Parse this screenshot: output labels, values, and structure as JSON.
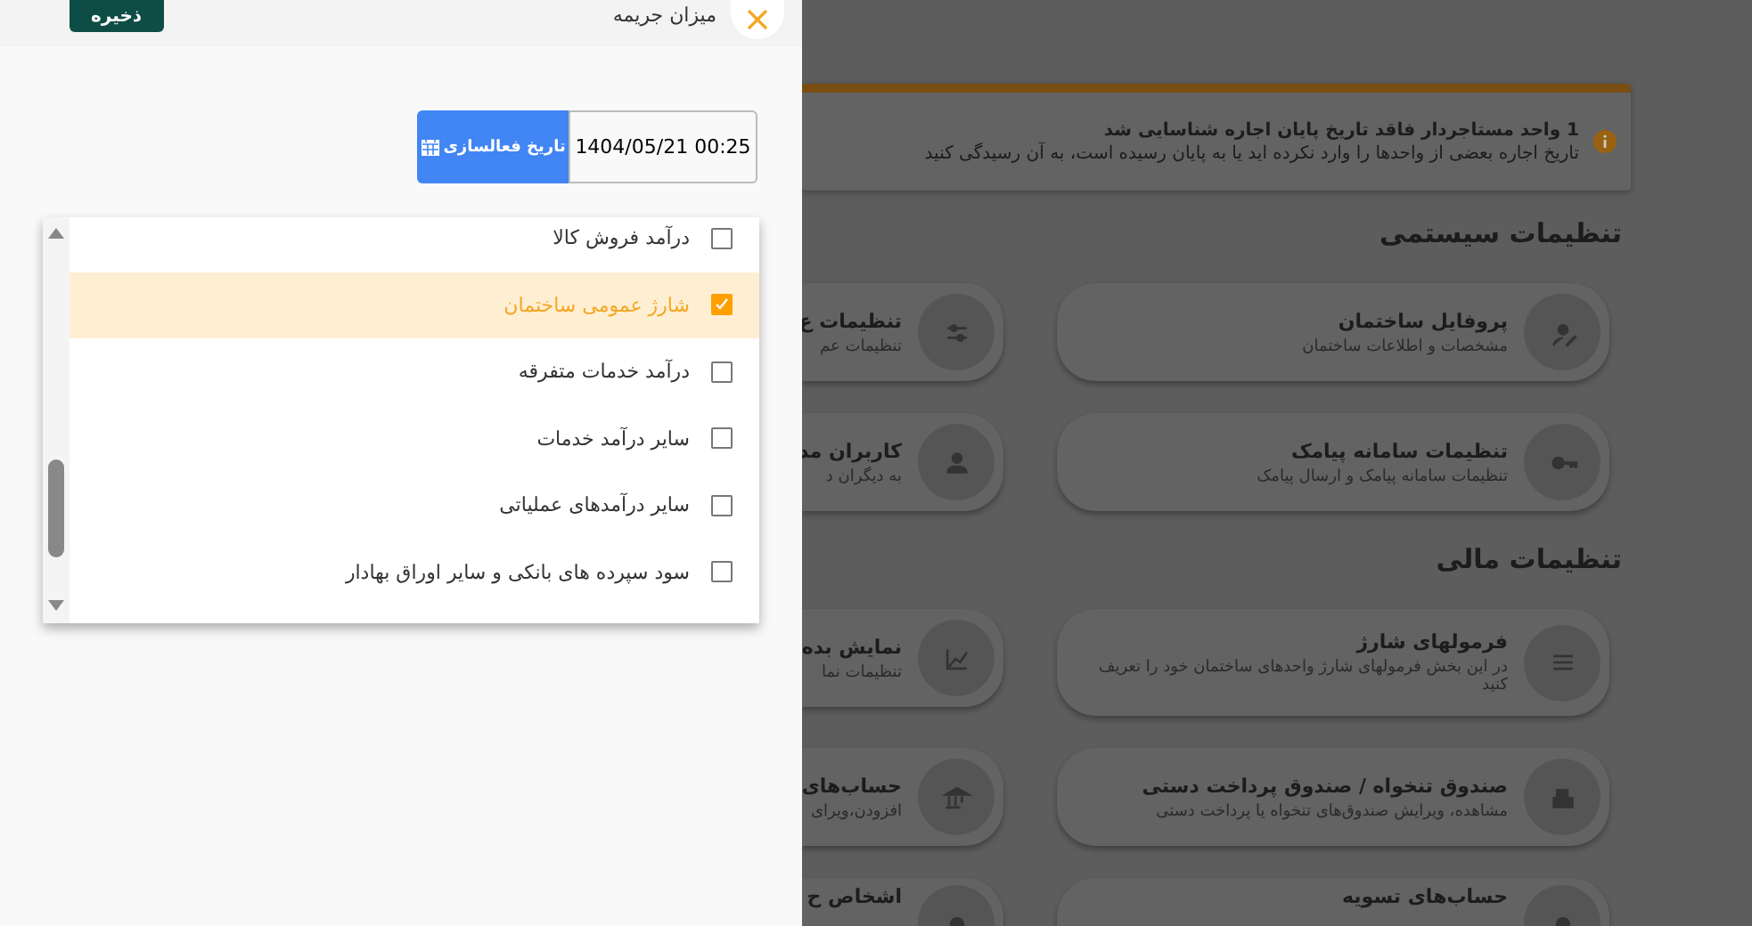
{
  "drawer": {
    "title": "میزان جریمه",
    "save_button": "ذخیره",
    "date_field": {
      "button": "تاریخ فعالسازی",
      "value": "1404/05/21 00:25"
    },
    "options": [
      {
        "label": "درآمد فروش کالا",
        "checked": false,
        "selected": false
      },
      {
        "label": "شارژ عمومی ساختمان",
        "checked": true,
        "selected": true
      },
      {
        "label": "درآمد خدمات متفرقه",
        "checked": false,
        "selected": false
      },
      {
        "label": "سایر درآمد خدمات",
        "checked": false,
        "selected": false
      },
      {
        "label": "سایر درآمدهای عملیاتی",
        "checked": false,
        "selected": false
      },
      {
        "label": "سود سپرده های بانکی و سایر اوراق بهادار",
        "checked": false,
        "selected": false
      }
    ]
  },
  "page": {
    "alert": {
      "title": "1 واحد مستاجردار فاقد تاریخ پایان اجاره شناسایی شد",
      "message": "تاریخ اجاره بعضی از واحدها را وارد نکرده اید یا به پایان رسیده است، به آن رسیدگی کنید"
    },
    "sections": [
      {
        "heading": "تنظیمات سیستمی",
        "rows": [
          {
            "cards": [
              {
                "title": "پروفایل ساختمان",
                "subtitle": "مشخصات و اطلاعات ساختمان"
              },
              {
                "title": "تنظیمات ع",
                "subtitle": "تنظیمات عم"
              }
            ]
          },
          {
            "cards": [
              {
                "title": "تنظیمات سامانه پیامک",
                "subtitle": "تنظیمات سامانه پیامک و ارسال پیامک"
              },
              {
                "title": "کاربران مد",
                "subtitle": "به دیگران د"
              }
            ]
          }
        ]
      },
      {
        "heading": "تنظیمات مالی",
        "rows": [
          {
            "cards": [
              {
                "title": "فرمولهای شارژ",
                "subtitle": "در این بخش فرمولهای شارژ واحدهای ساختمان خود را تعریف کنید"
              },
              {
                "title": "نمایش بده",
                "subtitle": "تنظیمات نما"
              }
            ]
          },
          {
            "cards": [
              {
                "title": "صندوق تنخواه / صندوق پرداخت دستی",
                "subtitle": "مشاهده، ویرایش صندوق‌های تنخواه یا پرداخت دستی"
              },
              {
                "title": "حساب‌های",
                "subtitle": "افزودن،ویرای"
              }
            ]
          },
          {
            "cards": [
              {
                "title": "حساب‌های تسویه"
              },
              {
                "title": "اشخاص ح"
              }
            ]
          }
        ]
      }
    ]
  }
}
